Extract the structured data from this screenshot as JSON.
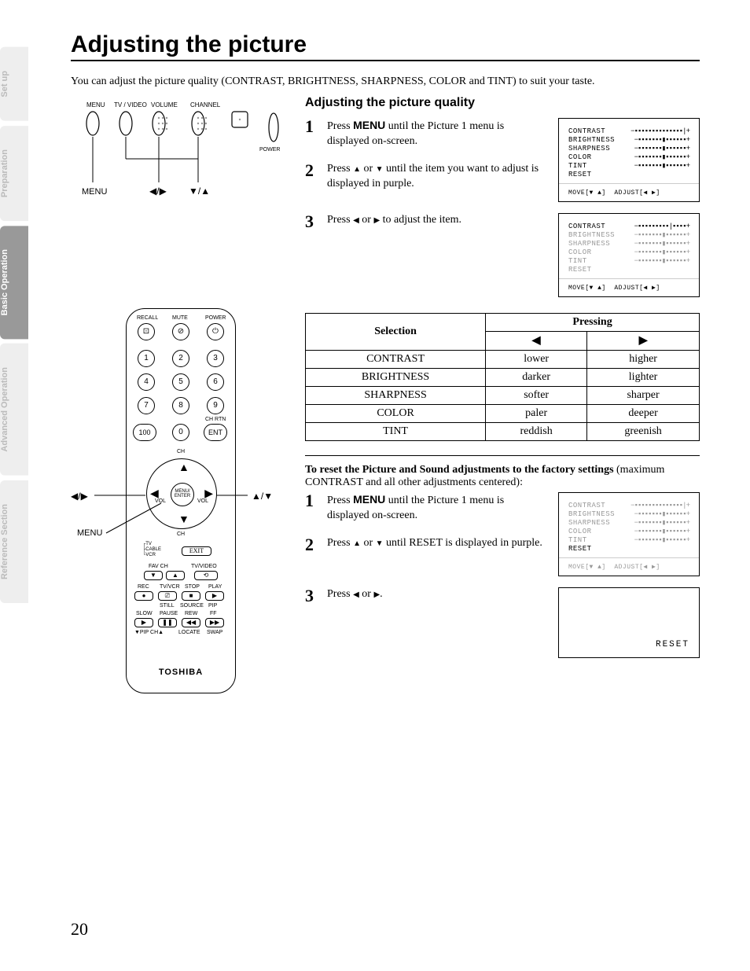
{
  "tabs": [
    "Set up",
    "Preparation",
    "Basic Operation",
    "Advanced Operation",
    "Reference Section"
  ],
  "h1": "Adjusting the picture",
  "intro": "You can adjust the picture quality (CONTRAST, BRIGHTNESS, SHARPNESS, COLOR and TINT) to suit your taste.",
  "sec_title": "Adjusting the picture quality",
  "steps": {
    "s1a": "Press ",
    "s1b": "MENU",
    "s1c": " until the Picture 1 menu is displayed on-screen.",
    "s2a": "Press ",
    "s2b": " or ",
    "s2c": " until the item you want to adjust is displayed in purple.",
    "s3a": "Press ",
    "s3b": " or ",
    "s3c": " to adjust the item."
  },
  "osd": {
    "items": [
      "CONTRAST",
      "BRIGHTNESS",
      "SHARPNESS",
      "COLOR",
      "TINT",
      "RESET"
    ],
    "hint_move": "MOVE[▼ ▲]",
    "hint_adjust": "ADJUST[◀ ▶]"
  },
  "table": {
    "h_sel": "Selection",
    "h_press": "Pressing",
    "rows": [
      {
        "sel": "CONTRAST",
        "l": "lower",
        "r": "higher"
      },
      {
        "sel": "BRIGHTNESS",
        "l": "darker",
        "r": "lighter"
      },
      {
        "sel": "SHARPNESS",
        "l": "softer",
        "r": "sharper"
      },
      {
        "sel": "COLOR",
        "l": "paler",
        "r": "deeper"
      },
      {
        "sel": "TINT",
        "l": "reddish",
        "r": "greenish"
      }
    ]
  },
  "reset": {
    "intro_b": "To reset the Picture and Sound adjustments to the factory settings",
    "intro_rest": " (maximum CONTRAST and all other adjustments centered):",
    "s1a": "Press ",
    "s1b": "MENU",
    "s1c": " until the Picture 1 menu is displayed on-screen.",
    "s2a": "Press ",
    "s2b": " or ",
    "s2c": " until RESET is displayed in purple.",
    "s3a": "Press ",
    "s3b": " or ",
    "s3c": ".",
    "reset_lbl": "RESET"
  },
  "diagram": {
    "menu": "MENU",
    "lr": "◀/▶",
    "ud": "▼/▲",
    "updown": "▲/▼",
    "top_labels": [
      "MENU",
      "TV / VIDEO",
      "VOLUME",
      "CHANNEL"
    ],
    "power": "POWER"
  },
  "remote": {
    "brand": "TOSHIBA",
    "top_labels": [
      "RECALL",
      "MUTE",
      "POWER"
    ],
    "chrtn": "CH RTN",
    "ent": "ENT",
    "hundred": "100",
    "menu_enter": "MENU/\nENTER",
    "ch": "CH",
    "vol": "VOL",
    "switch": [
      "TV",
      "CABLE",
      "VCR"
    ],
    "exit": "EXIT",
    "favch": "FAV CH",
    "tvvideo": "TV/VIDEO",
    "row1": [
      "REC",
      "TV/VCR",
      "STOP",
      "PLAY"
    ],
    "row2": [
      "SLOW",
      "PAUSE",
      "REW",
      "FF"
    ],
    "row3": [
      "▼PIP CH▲",
      "LOCATE",
      "SWAP"
    ],
    "row_mid": [
      "STILL",
      "SOURCE",
      "PIP"
    ]
  },
  "page_num": "20"
}
